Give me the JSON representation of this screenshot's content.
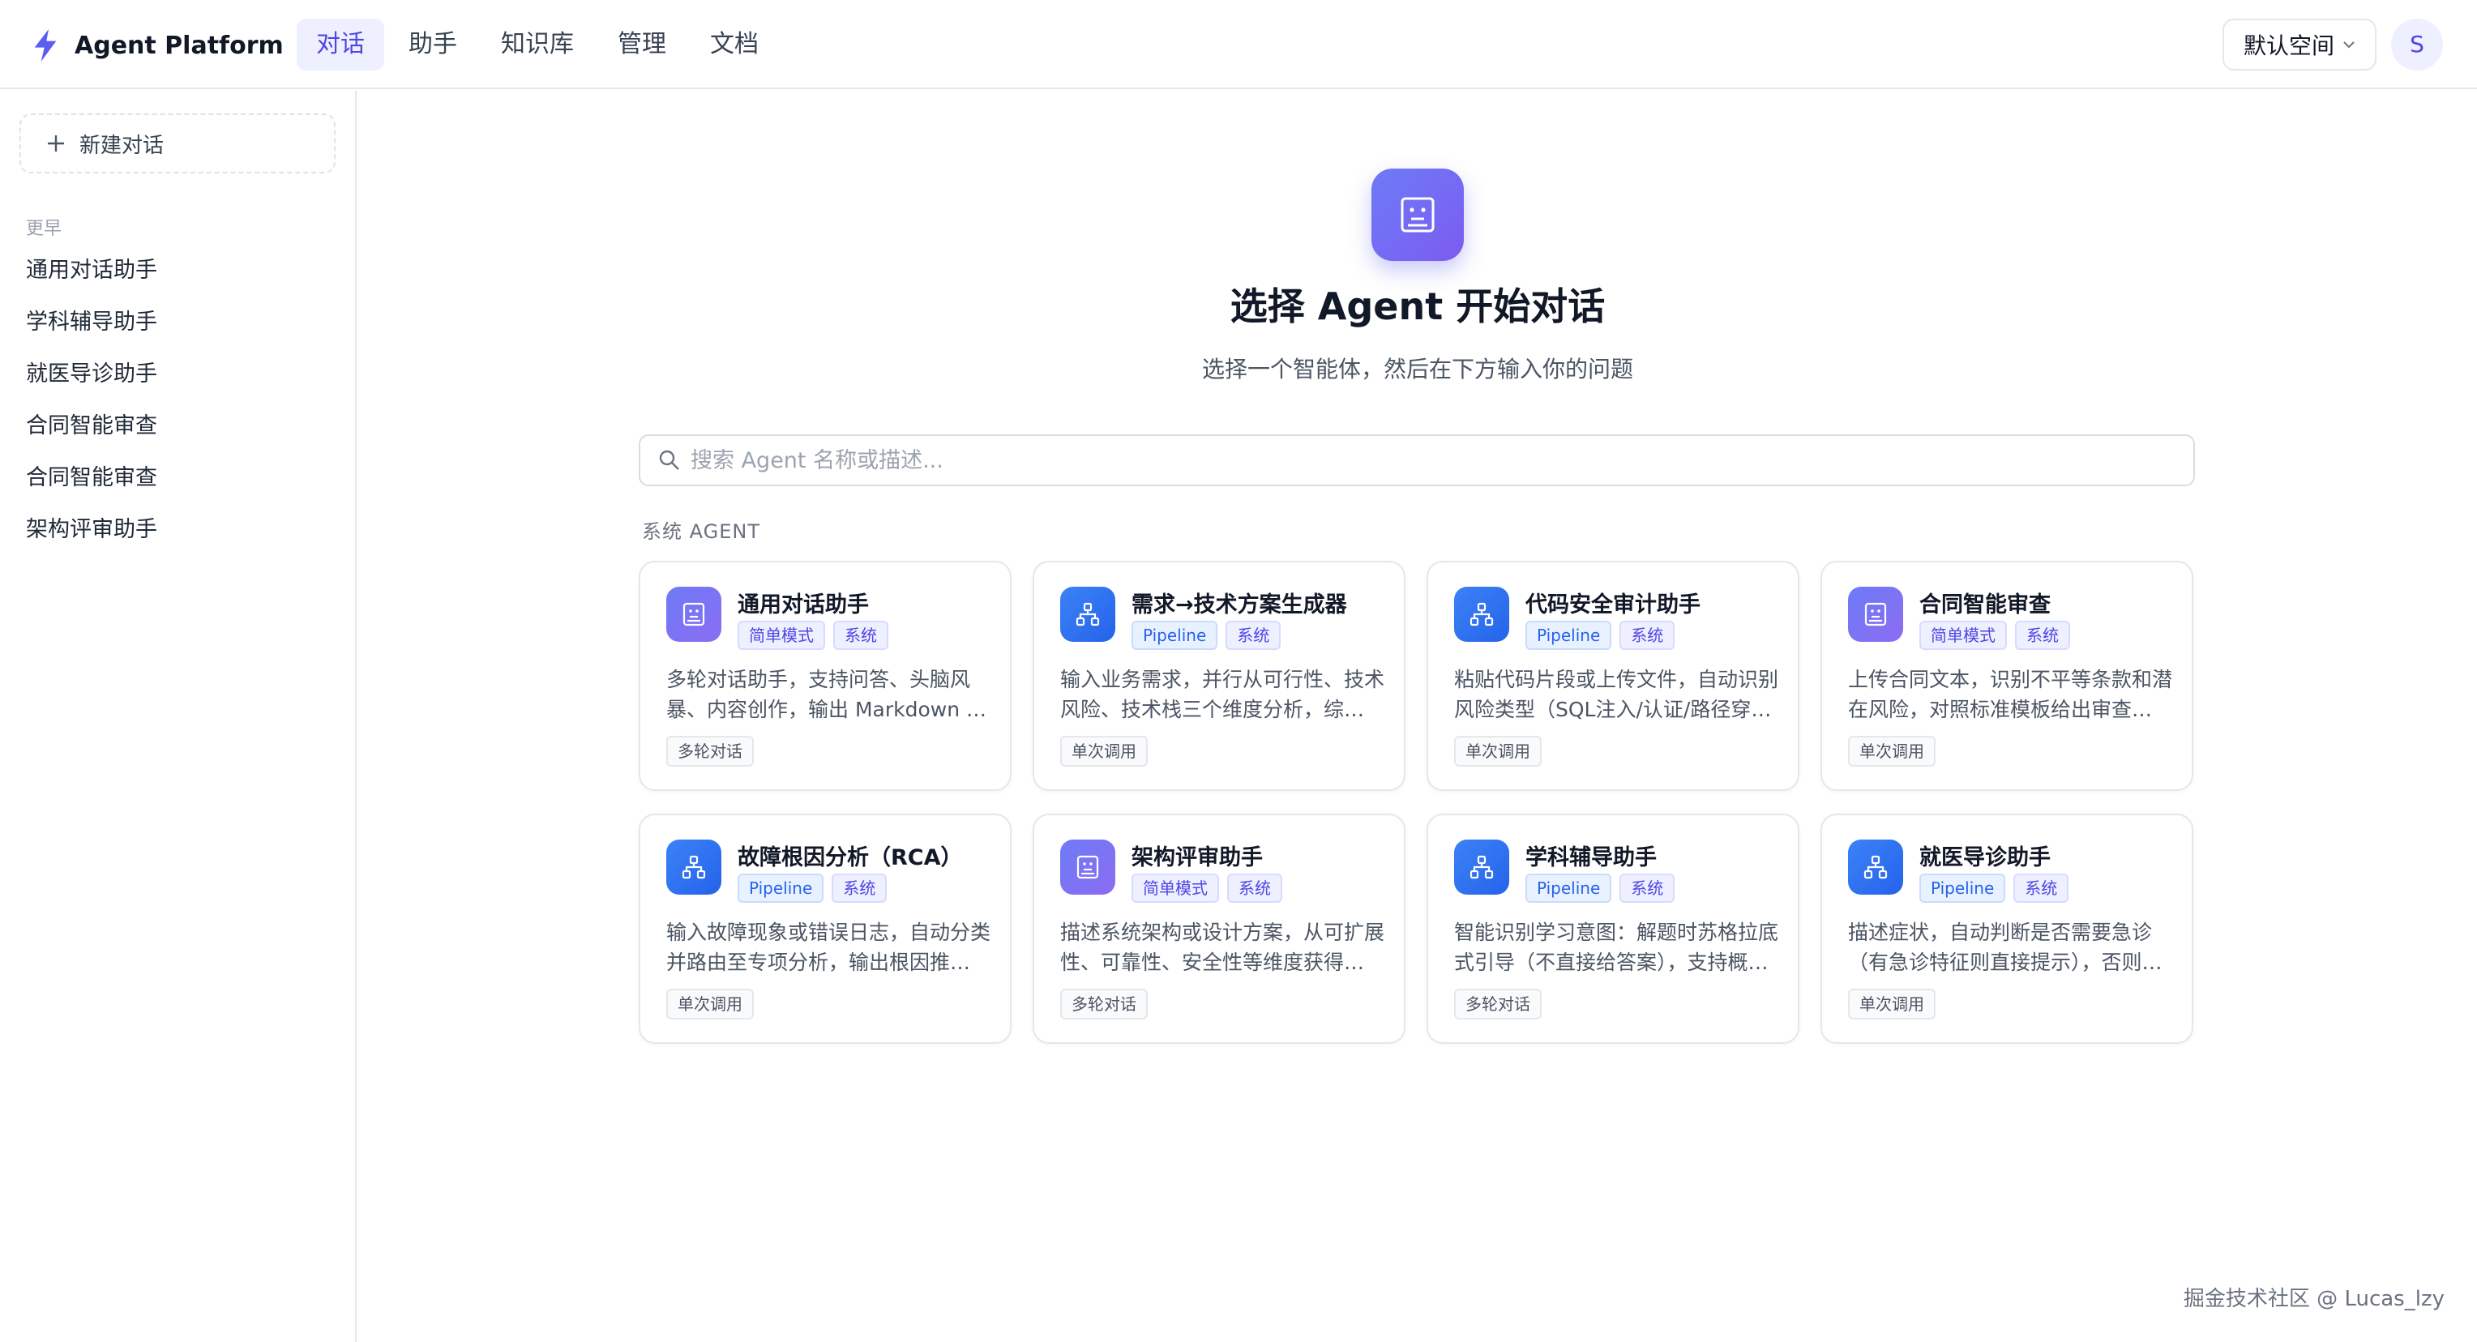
{
  "app": {
    "brand": "Agent Platform",
    "accent": "#4f46e5",
    "nav": [
      "对话",
      "助手",
      "知识库",
      "管理",
      "文档"
    ],
    "active_nav": "对话",
    "workspace": "默认空间",
    "avatar_initial": "S"
  },
  "sidebar": {
    "new_chat_label": "新建对话",
    "section_label": "更早",
    "history": [
      "通用对话助手",
      "学科辅导助手",
      "就医导诊助手",
      "合同智能审查",
      "合同智能审查",
      "架构评审助手"
    ]
  },
  "main": {
    "title": "选择 Agent 开始对话",
    "subtitle": "选择一个智能体，然后在下方输入你的问题",
    "search_placeholder": "搜索 Agent 名称或描述...",
    "group_label": "系统 AGENT",
    "cards": [
      {
        "icon": "robot-icon",
        "title": "通用对话助手",
        "tag1": "简单模式",
        "tag2": "系统",
        "desc": "多轮对话助手，支持问答、头脑风暴、内容创作，输出 Markdown 格式的回答。",
        "badge": "多轮对话"
      },
      {
        "icon": "network-icon",
        "title": "需求→技术方案生成器",
        "tag1": "Pipeline",
        "tag2": "系统",
        "desc": "输入业务需求，并行从可行性、技术风险、技术栈三个维度分析，综合生成方案。",
        "badge": "单次调用"
      },
      {
        "icon": "network-icon",
        "title": "代码安全审计助手",
        "tag1": "Pipeline",
        "tag2": "系统",
        "desc": "粘贴代码片段或上传文件，自动识别风险类型（SQL注入/认证/路径穿越等）。",
        "badge": "单次调用"
      },
      {
        "icon": "robot-icon",
        "title": "合同智能审查",
        "tag1": "简单模式",
        "tag2": "系统",
        "desc": "上传合同文本，识别不平等条款和潜在风险，对照标准模板给出审查意见。",
        "badge": "单次调用"
      },
      {
        "icon": "network-icon",
        "title": "故障根因分析（RCA）",
        "tag1": "Pipeline",
        "tag2": "系统",
        "desc": "输入故障现象或错误日志，自动分类并路由至专项分析，输出根因推断与建议。",
        "badge": "单次调用"
      },
      {
        "icon": "robot-icon",
        "title": "架构评审助手",
        "tag1": "简单模式",
        "tag2": "系统",
        "desc": "描述系统架构或设计方案，从可扩展性、可靠性、安全性等维度获得评审意见。",
        "badge": "多轮对话"
      },
      {
        "icon": "network-icon",
        "title": "学科辅导助手",
        "tag1": "Pipeline",
        "tag2": "系统",
        "desc": "智能识别学习意图：解题时苏格拉底式引导（不直接给答案），支持概念讲解。",
        "badge": "多轮对话"
      },
      {
        "icon": "network-icon",
        "title": "就医导诊助手",
        "tag1": "Pipeline",
        "tag2": "系统",
        "desc": "描述症状，自动判断是否需要急诊（有急诊特征则直接提示），否则推荐科室。",
        "badge": "单次调用"
      }
    ]
  },
  "watermark": "掘金技术社区 @ Lucas_lzy"
}
